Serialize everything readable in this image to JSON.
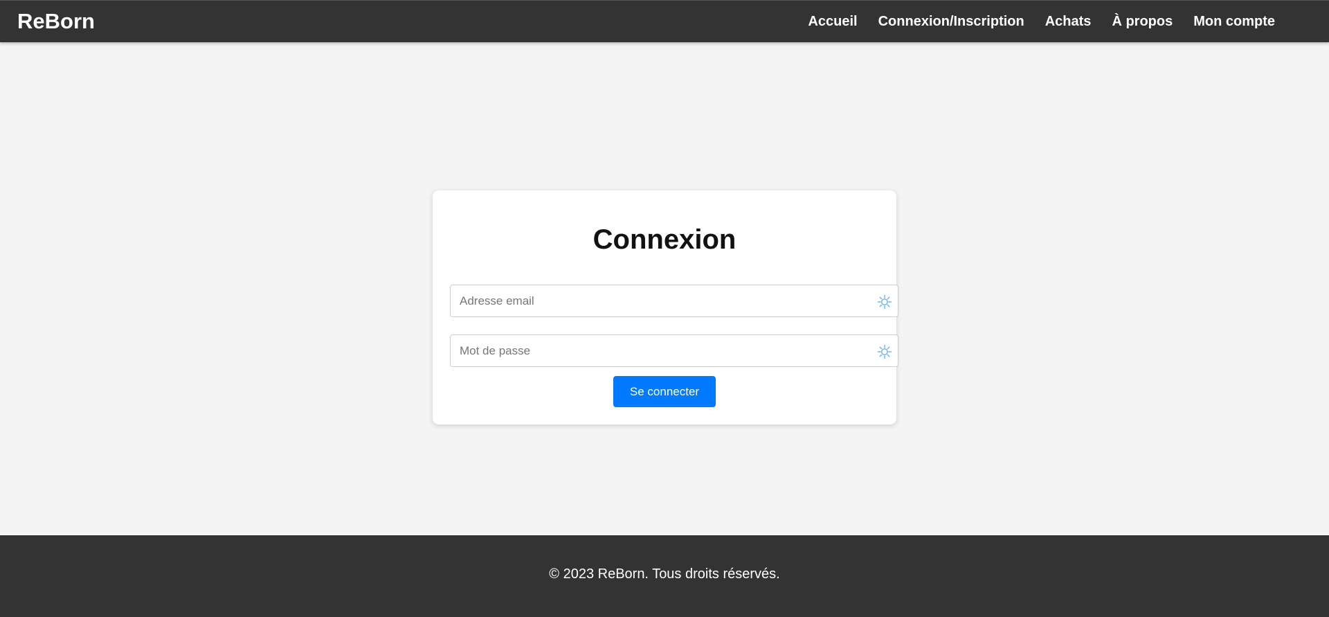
{
  "header": {
    "brand": "ReBorn",
    "nav": [
      {
        "label": "Accueil"
      },
      {
        "label": "Connexion/Inscription"
      },
      {
        "label": "Achats"
      },
      {
        "label": "À propos"
      },
      {
        "label": "Mon compte"
      }
    ]
  },
  "login": {
    "title": "Connexion",
    "email": {
      "placeholder": "Adresse email",
      "value": "",
      "icon": "password-manager-icon"
    },
    "password": {
      "placeholder": "Mot de passe",
      "value": "",
      "icon": "password-manager-icon"
    },
    "submit_label": "Se connecter"
  },
  "footer": {
    "copyright": "© 2023 ReBorn. Tous droits réservés."
  },
  "colors": {
    "header_bg": "#333333",
    "page_bg": "#f4f4f4",
    "accent": "#007bff",
    "icon": "#6ab0f3"
  }
}
